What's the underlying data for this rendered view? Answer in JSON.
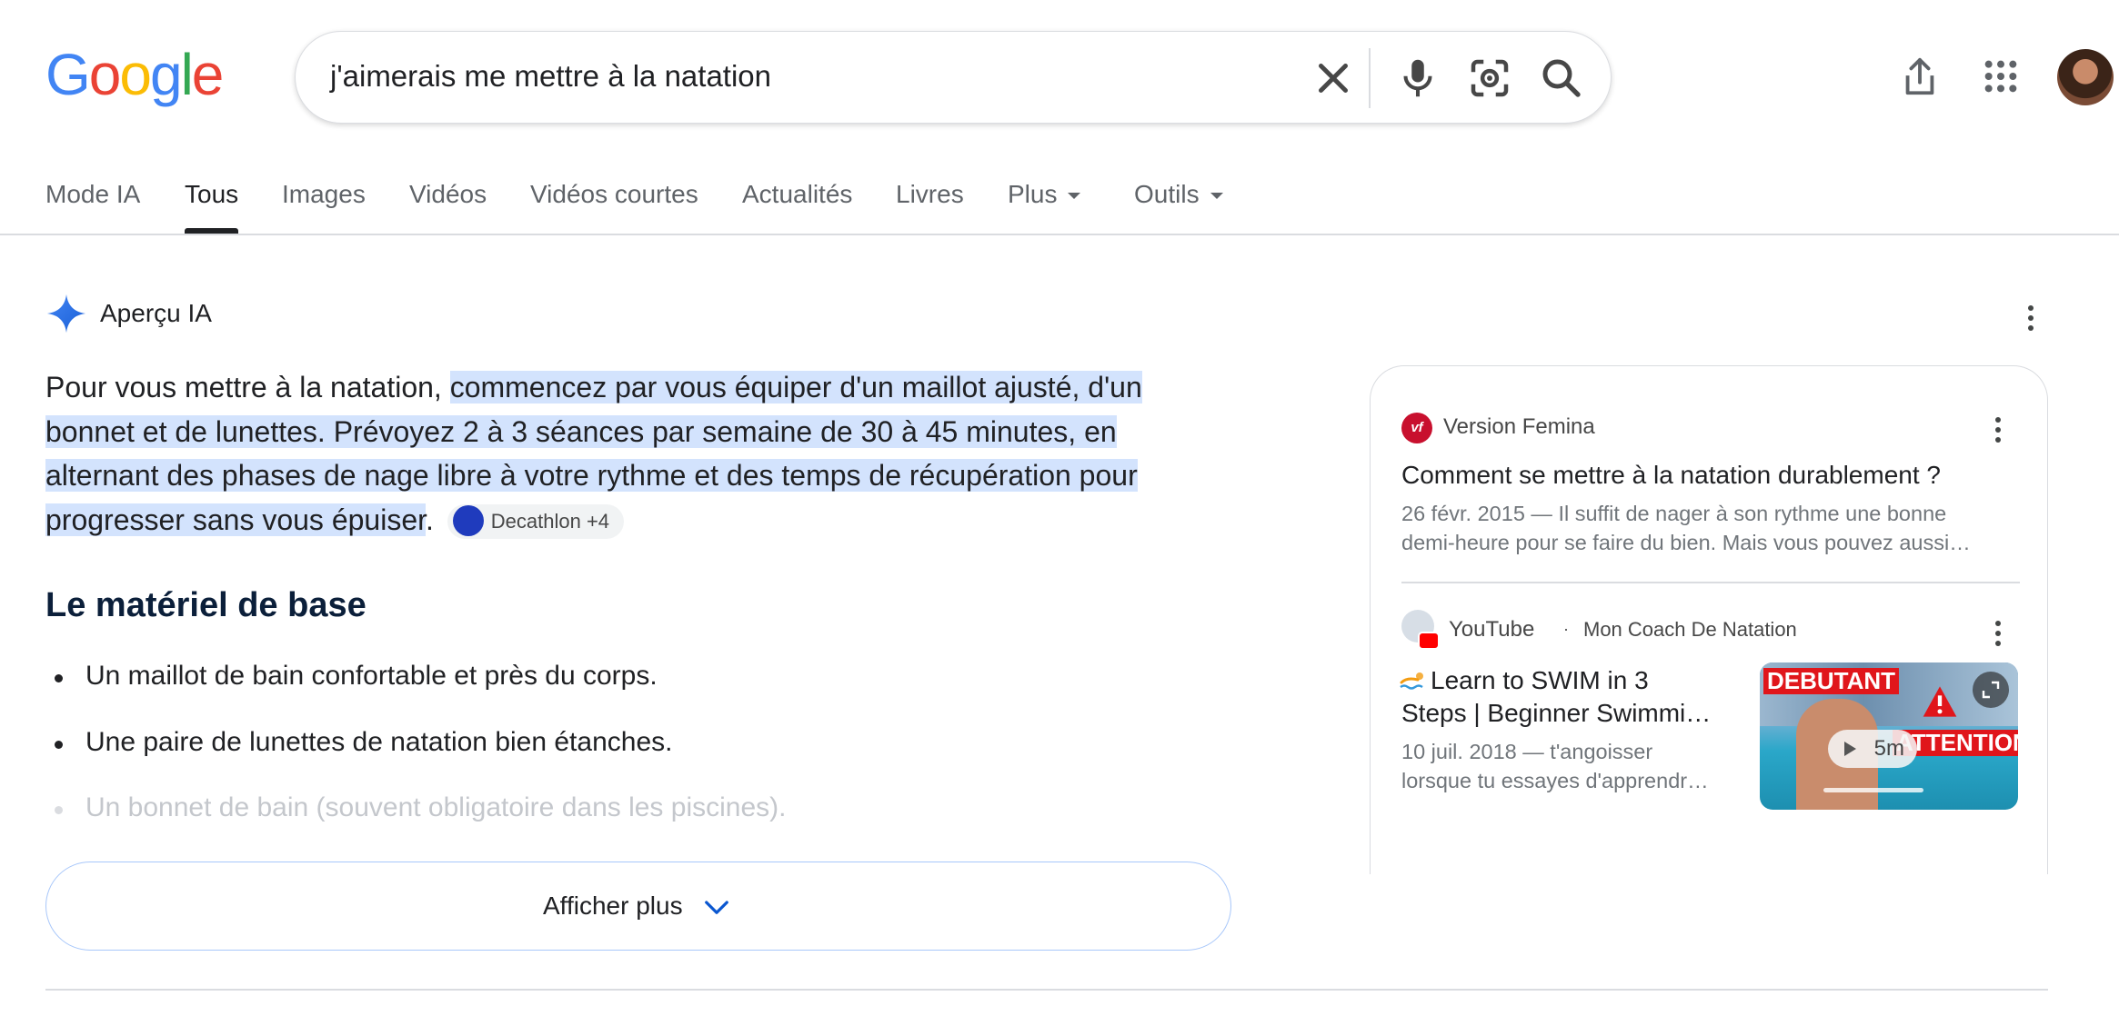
{
  "header": {
    "logo_letters": [
      {
        "ch": "G",
        "color": "#4285F4"
      },
      {
        "ch": "o",
        "color": "#EA4335"
      },
      {
        "ch": "o",
        "color": "#FBBC05"
      },
      {
        "ch": "g",
        "color": "#4285F4"
      },
      {
        "ch": "l",
        "color": "#34A853"
      },
      {
        "ch": "e",
        "color": "#EA4335"
      }
    ],
    "search_query": "j'aimerais me mettre à la natation",
    "icons": [
      "close-icon",
      "microphone-icon",
      "lens-icon",
      "search-icon",
      "share-icon",
      "apps-grid-icon",
      "avatar"
    ]
  },
  "tabs": [
    {
      "label": "Mode IA"
    },
    {
      "label": "Tous",
      "active": true
    },
    {
      "label": "Images"
    },
    {
      "label": "Vidéos"
    },
    {
      "label": "Vidéos courtes"
    },
    {
      "label": "Actualités"
    },
    {
      "label": "Livres"
    },
    {
      "label": "Plus",
      "dropdown": true
    },
    {
      "label": "Outils",
      "dropdown": true
    }
  ],
  "ai_overview": {
    "title": "Aperçu IA",
    "intro_plain": "Pour vous mettre à la natation, ",
    "intro_highlight_lines": [
      "commencez par vous équiper d'un maillot ajusté, d'un",
      "bonnet et de lunettes. Prévoyez 2 à 3 séances par semaine de 30 à 45 minutes, en",
      "alternant des phases de nage libre à votre rythme et des temps de récupération pour",
      "progresser sans vous épuiser"
    ],
    "intro_end": ".",
    "citation_chip": "Decathlon +4",
    "section_heading": "Le matériel de base",
    "bullets": [
      "Un maillot de bain confortable et près du corps.",
      "Une paire de lunettes de natation bien étanches.",
      "Un bonnet de bain (souvent obligatoire dans les piscines)."
    ],
    "show_more": "Afficher plus"
  },
  "sources": [
    {
      "site": "Version Femina",
      "title": "Comment se mettre à la natation durablement ?",
      "snippet_lines": [
        "26 févr. 2015 — Il suffit de nager à son rythme une bonne",
        "demi-heure pour se faire du bien. Mais vous pouvez aussi…"
      ]
    },
    {
      "site": "YouTube",
      "channel": "Mon Coach De Natation",
      "separator": "·",
      "title_lines": [
        "Learn to SWIM in 3",
        "Steps | Beginner Swimmi…"
      ],
      "snippet_lines": [
        "10 juil. 2018 — t'angoisser",
        "lorsque tu essayes d'apprendr…"
      ],
      "thumbnail": {
        "label_top": "DEBUTANT",
        "label_bottom": "ATTENTION",
        "duration": "5m"
      }
    }
  ]
}
